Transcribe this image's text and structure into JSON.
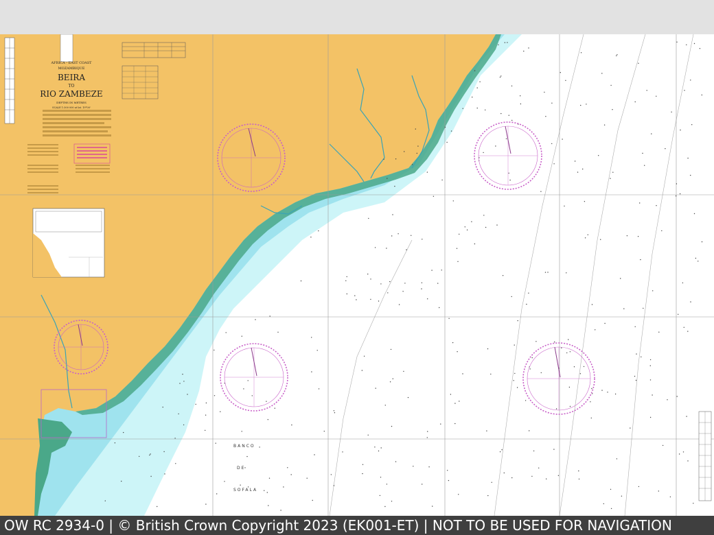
{
  "chart_title": {
    "region_line_1": "AFRICA - EAST COAST",
    "region_line_2": "MOZAMBIQUE",
    "title_line_1": "BEIRA",
    "title_line_2": "TO",
    "title_line_3": "RIO ZAMBEZE",
    "subtitle_1": "DEPTHS IN METRES",
    "subtitle_2": "SCALE 1:300 000 at lat. 19°00'"
  },
  "place_labels": {
    "banco_1": "BANCO",
    "banco_2": "DE",
    "banco_3": "SOFALA"
  },
  "footer": {
    "caption": "OW RC 2934-0 | © British Crown Copyright 2023 (EK001-ET) | NOT TO BE USED FOR NAVIGATION"
  },
  "colors": {
    "land": "#f3c266",
    "shallow": "#9fe3ee",
    "mid_water": "#cdf5f8",
    "deep_water": "#ffffff",
    "drying": "#4aa889",
    "compass_rose": "#c85fc8",
    "caption_bg": "#3f3f3f"
  },
  "icons": {
    "compass_rose": "compass-rose-icon"
  }
}
